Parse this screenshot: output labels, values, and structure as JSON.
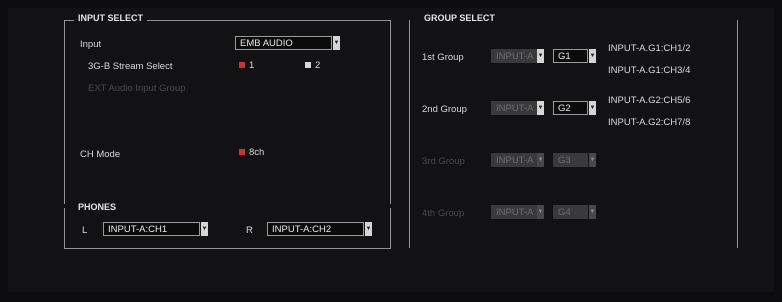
{
  "colors": {
    "background": "#0c0c0e",
    "panel": "#121214",
    "frame": "#8f9296",
    "checkbox_checked": "#c23636"
  },
  "input_select": {
    "title": "INPUT SELECT",
    "input_label": "Input",
    "input_value": "EMB AUDIO",
    "stream_label": "3G-B Stream Select",
    "stream_option_1": "1",
    "stream_option_1_checked": true,
    "stream_option_2": "2",
    "stream_option_2_checked": false,
    "ext_audio_label": "EXT Audio Input Group",
    "ch_mode_label": "CH Mode",
    "ch_mode_option": "8ch",
    "ch_mode_checked": true
  },
  "phones": {
    "title": "PHONES",
    "left_label": "L",
    "left_value": "INPUT-A:CH1",
    "right_label": "R",
    "right_value": "INPUT-A:CH2"
  },
  "group_select": {
    "title": "GROUP SELECT",
    "groups": [
      {
        "label": "1st Group",
        "input": "INPUT-A",
        "group": "G1",
        "channels": [
          "INPUT-A.G1:CH1/2",
          "INPUT-A.G1:CH3/4"
        ],
        "enabled": true
      },
      {
        "label": "2nd Group",
        "input": "INPUT-A",
        "group": "G2",
        "channels": [
          "INPUT-A.G2:CH5/6",
          "INPUT-A.G2:CH7/8"
        ],
        "enabled": true
      },
      {
        "label": "3rd Group",
        "input": "INPUT-A",
        "group": "G3",
        "channels": [],
        "enabled": false
      },
      {
        "label": "4th Group",
        "input": "INPUT-A",
        "group": "G4",
        "channels": [],
        "enabled": false
      }
    ]
  }
}
